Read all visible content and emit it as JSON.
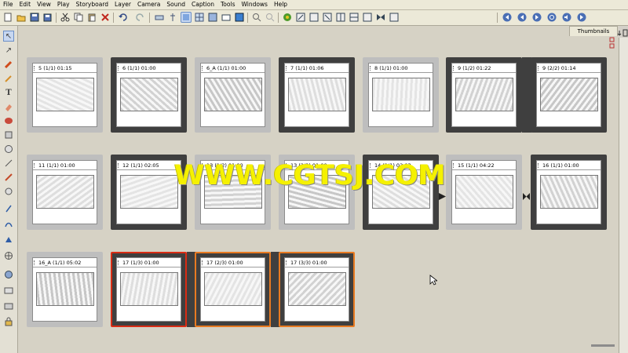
{
  "menu": [
    "File",
    "Edit",
    "View",
    "Play",
    "Storyboard",
    "Layer",
    "Camera",
    "Sound",
    "Caption",
    "Tools",
    "Windows",
    "Help"
  ],
  "tab": {
    "label": "Thumbnails"
  },
  "panels": [
    {
      "label": "5 (1/1) 01:15",
      "selected": false,
      "frame": "light"
    },
    {
      "label": "6 (1/1) 01:00",
      "selected": true,
      "frame": "dark"
    },
    {
      "label": "6_A (1/1) 01:00",
      "selected": false,
      "frame": "light"
    },
    {
      "label": "7 (1/1) 01:06",
      "selected": true,
      "frame": "dark"
    },
    {
      "label": "8 (1/1) 01:00",
      "selected": false,
      "frame": "light"
    },
    {
      "label": "9 (1/2) 01:22",
      "selected": true,
      "frame": "dark"
    },
    {
      "label": "9 (2/2) 01:14",
      "selected": true,
      "frame": "dark"
    },
    {
      "label": "11 (1/1) 01:00",
      "selected": false,
      "frame": "light"
    },
    {
      "label": "12 (1/1) 02:05",
      "selected": true,
      "frame": "dark"
    },
    {
      "label": "13 (1/2) 01:00",
      "selected": false,
      "frame": "light"
    },
    {
      "label": "13 (2/2) 01:00",
      "selected": false,
      "frame": "light"
    },
    {
      "label": "14 (1/1) 02:03",
      "selected": true,
      "frame": "dark"
    },
    {
      "label": "15 (1/1) 04:22",
      "selected": false,
      "frame": "light"
    },
    {
      "label": "16 (1/1) 01:00",
      "selected": true,
      "frame": "dark"
    },
    {
      "label": "16_A (1/1) 05:02",
      "selected": false,
      "frame": "light"
    },
    {
      "label": "17 (1/3) 01:00",
      "selected": true,
      "frame": "red"
    },
    {
      "label": "17 (2/3) 01:00",
      "selected": true,
      "frame": "orange"
    },
    {
      "label": "17 (3/3) 01:00",
      "selected": true,
      "frame": "orange"
    }
  ],
  "watermark": "WWW.CGTSJ.COM",
  "icons": {
    "toolbar": [
      "new-icon",
      "open-icon",
      "save-icon",
      "save-all-icon",
      "cut-icon",
      "copy-icon",
      "paste-icon",
      "delete-icon",
      "undo-icon",
      "redo-icon",
      "transform-icon",
      "pin-icon",
      "light-table-icon",
      "grid-icon",
      "panel-view-icon",
      "camera-view-icon",
      "thumbnail-icon",
      "search-icon",
      "zoom-icon",
      "paint-icon",
      "new-panel-icon",
      "duplicate-icon",
      "delete-panel-icon",
      "split-icon",
      "merge-icon",
      "scene-icon",
      "transition-icon",
      "first-frame-icon",
      "prev-frame-icon",
      "play-icon",
      "loop-icon",
      "sound-icon",
      "last-frame-icon"
    ],
    "left": [
      "select-icon",
      "contour-icon",
      "brush-icon",
      "pencil-icon",
      "text-icon",
      "eraser-icon",
      "ellipse-icon",
      "rectangle-icon",
      "line-icon",
      "polyline-icon",
      "hand-icon",
      "rotate-icon",
      "zoom-icon",
      "camera-icon",
      "layer-icon",
      "lock-icon",
      "unlock-icon"
    ]
  },
  "colors": {
    "selected_frame": "#3f3f3f",
    "red_frame": "#d92c14",
    "orange_frame": "#e87a21",
    "watermark": "#f5f100"
  }
}
